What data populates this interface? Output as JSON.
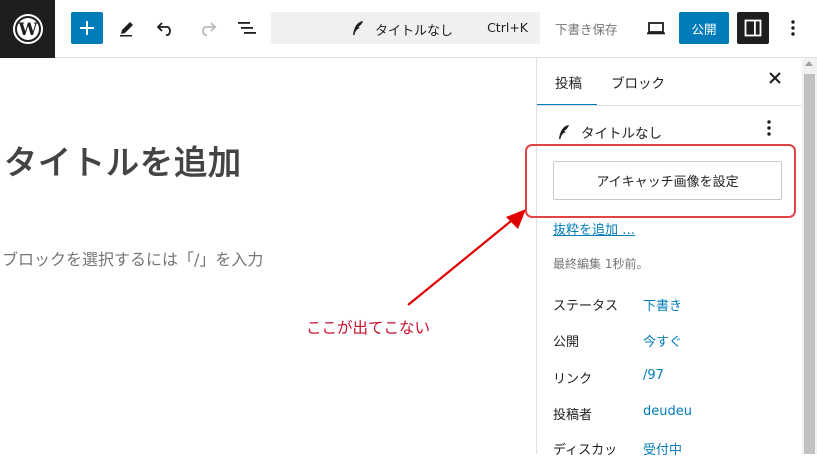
{
  "toolbar": {
    "post_title": "タイトルなし",
    "shortcut": "Ctrl+K",
    "save_draft_label": "下書き保存",
    "publish_label": "公開"
  },
  "editor": {
    "title_placeholder": "タイトルを追加",
    "block_hint": "ブロックを選択するには「/」を入力"
  },
  "sidebar": {
    "tabs": [
      "投稿",
      "ブロック"
    ],
    "doc_title": "タイトルなし",
    "featured_image_label": "アイキャッチ画像を設定",
    "excerpt_link": "抜粋を追加 …",
    "last_edited": "最終編集 1秒前。",
    "rows": [
      {
        "label": "ステータス",
        "value": "下書き"
      },
      {
        "label": "公開",
        "value": "今すぐ"
      },
      {
        "label": "リンク",
        "value": "/97"
      },
      {
        "label": "投稿者",
        "value": "deudeu"
      },
      {
        "label": "ディスカッ",
        "value": "受付中"
      }
    ]
  },
  "annotation": {
    "text": "ここが出てこない",
    "color": "#c8102e"
  },
  "colors": {
    "accent": "#007cba",
    "highlight_box": "#e04545"
  }
}
